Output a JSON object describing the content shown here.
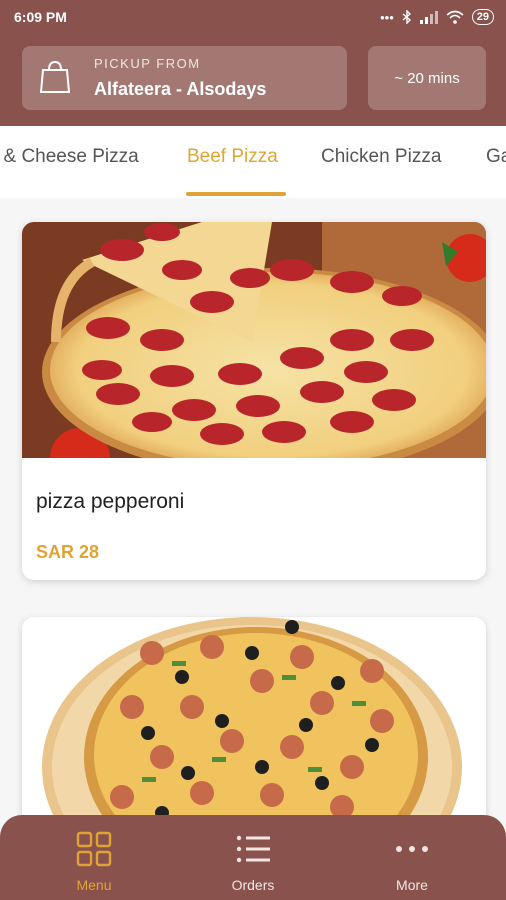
{
  "status_bar": {
    "time": "6:09 PM",
    "indicators": "•••",
    "battery": "29"
  },
  "header": {
    "pickup_label": "PICKUP FROM",
    "store_name": "Alfateera - Alsodays",
    "eta": "~ 20 mins",
    "bag_icon": "shopping-bag-icon"
  },
  "categories": {
    "items": [
      "i & Cheese Pizza",
      "Beef Pizza",
      "Chicken Pizza",
      "Ga"
    ],
    "active": "Beef Pizza"
  },
  "products": [
    {
      "name": "pizza pepperoni",
      "price": "SAR 28"
    }
  ],
  "bottom_nav": {
    "items": [
      {
        "label": "Menu",
        "icon": "grid-icon"
      },
      {
        "label": "Orders",
        "icon": "list-icon"
      },
      {
        "label": "More",
        "icon": "more-dots-icon"
      }
    ],
    "active": "Menu"
  },
  "colors": {
    "primary": "#8a524c",
    "accent": "#e0a434"
  }
}
